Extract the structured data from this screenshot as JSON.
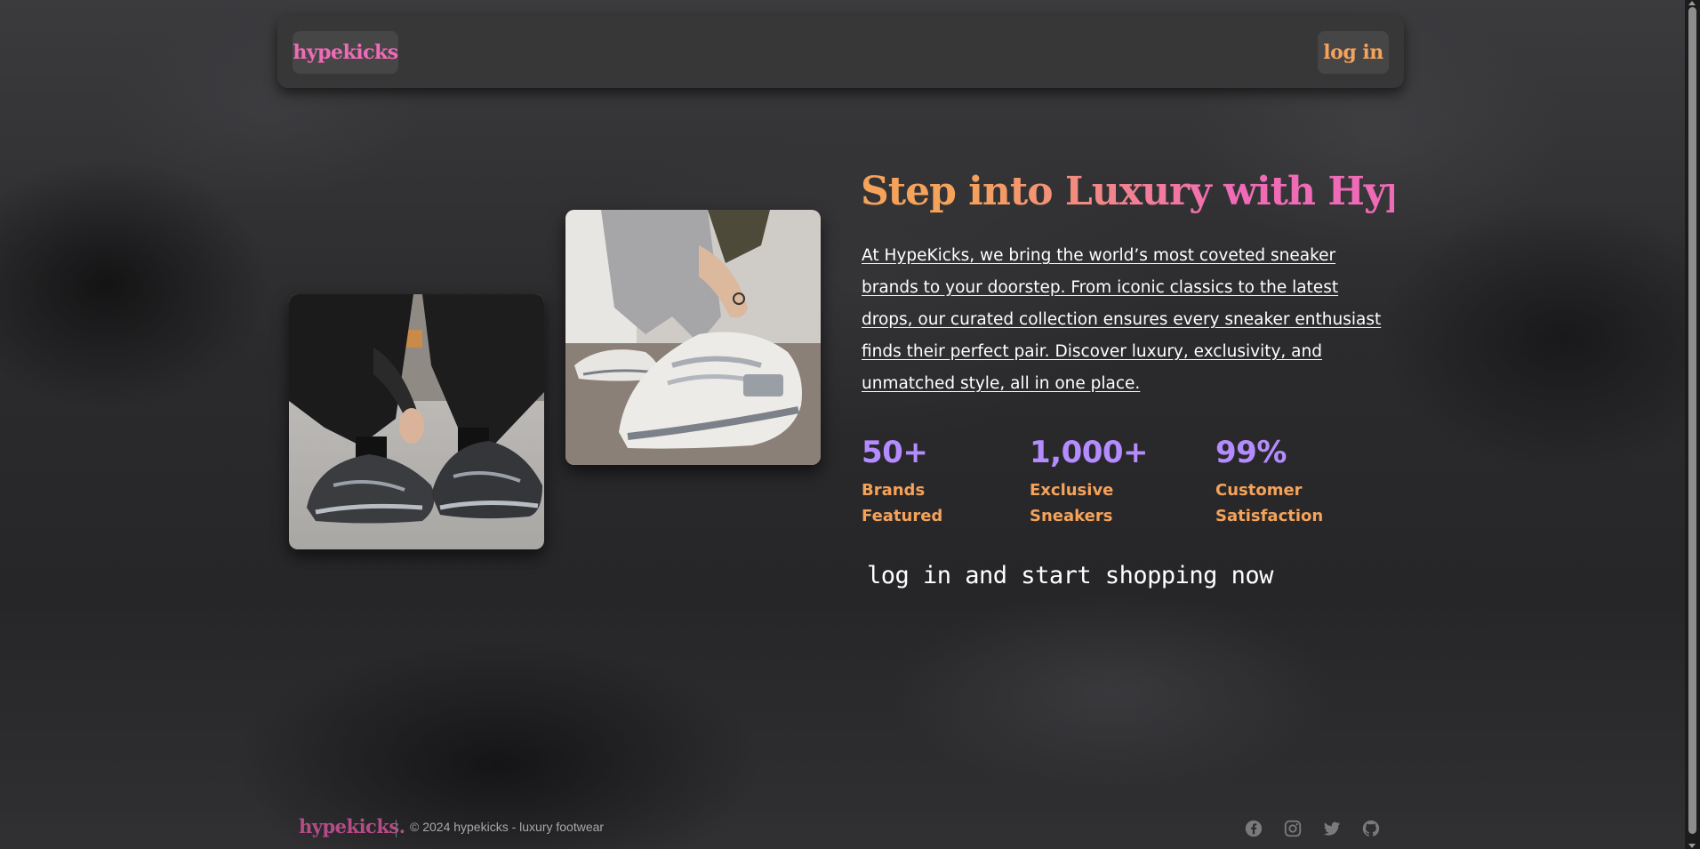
{
  "navbar": {
    "logo": "hypekicks",
    "login_label": "log in"
  },
  "hero": {
    "headline": "Step into Luxury with HypeKicks",
    "intro": "At HypeKicks, we bring the world’s most coveted sneaker brands to your doorstep. From iconic classics to the latest drops, our curated collection ensures every sneaker enthusiast finds their perfect pair. Discover luxury, exclusivity, and unmatched style, all in one place.",
    "cta": "log in and start shopping now",
    "stats": [
      {
        "value": "50+",
        "label_line1": "Brands",
        "label_line2": "Featured"
      },
      {
        "value": "1,000+",
        "label_line1": "Exclusive",
        "label_line2": "Sneakers"
      },
      {
        "value": "99%",
        "label_line1": "Customer",
        "label_line2": "Satisfaction"
      }
    ],
    "images": [
      {
        "icon": "sneaker-photo-black-chunky"
      },
      {
        "icon": "sneaker-photo-white-grey"
      }
    ]
  },
  "footer": {
    "logo": "hypekicks.",
    "copyright": "© 2024 hypekicks - luxury footwear",
    "social": [
      "facebook-icon",
      "instagram-icon",
      "twitter-icon",
      "github-icon"
    ]
  },
  "colors": {
    "accent_pink": "#f06bb6",
    "accent_orange": "#f5a25a",
    "accent_purple": "#b58cff",
    "navbar_bg": "#373738"
  }
}
